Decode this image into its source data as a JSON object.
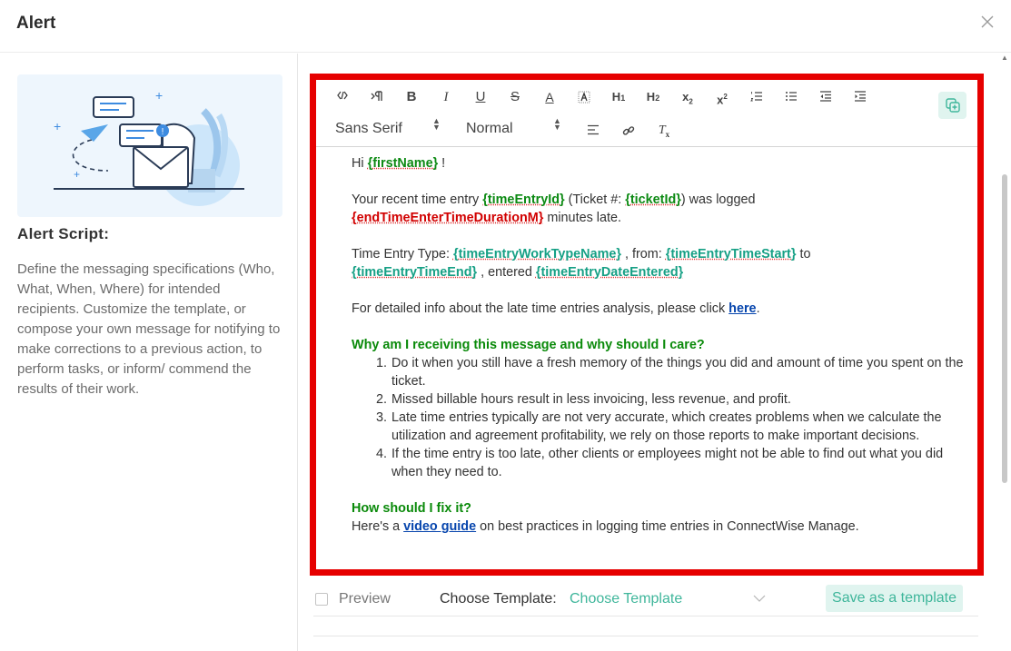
{
  "dialog": {
    "title": "Alert",
    "close_icon": "close-icon"
  },
  "sidebar": {
    "heading": "Alert Script:",
    "description": "Define the messaging specifications (Who, What, When, Where) for intended recipients. Customize the template, or compose your own message for notifying to make corrections to a previous action, to perform tasks, or inform/ commend the results of their work."
  },
  "toolbar": {
    "font_family": "Sans Serif",
    "font_size": "Normal",
    "buttons": [
      "code-view-icon",
      "text-direction-icon",
      "bold-icon",
      "italic-icon",
      "underline-icon",
      "strikethrough-icon",
      "font-color-icon",
      "background-color-icon",
      "heading-1-icon",
      "heading-2-icon",
      "subscript-icon",
      "superscript-icon",
      "ordered-list-icon",
      "bullet-list-icon",
      "outdent-icon",
      "indent-icon",
      "align-icon",
      "link-icon",
      "clear-format-icon",
      "duplicate-icon"
    ],
    "labels": {
      "b": "B",
      "i": "I",
      "u": "U",
      "s": "S",
      "a": "A",
      "h1": "H",
      "h1sub": "1",
      "h2": "H",
      "h2sub": "2",
      "sub": "x",
      "subsub": "2",
      "sup": "x",
      "supsup": "2",
      "tx": "T",
      "txsub": "x"
    }
  },
  "message": {
    "greeting": "Hi",
    "var_first_name": "{firstName}",
    "greeting_end": " !",
    "p1_a": "Your recent time entry ",
    "var_time_entry_id": "{timeEntryId}",
    "p1_b": " (Ticket #: ",
    "var_ticket_id": "{ticketId}",
    "p1_c": ") was logged",
    "var_duration": "{endTimeEnterTimeDurationM}",
    "p1_d": " minutes late.",
    "p2_a": "Time Entry Type: ",
    "var_work_type": "{timeEntryWorkTypeName}",
    "p2_b": " , from: ",
    "var_time_start": "{timeEntryTimeStart}",
    "p2_c": " to",
    "var_time_end": "{timeEntryTimeEnd}",
    "p2_d": " , entered ",
    "var_date_entered": "{timeEntryDateEntered}",
    "p3_a": "For detailed info about the late time entries analysis, please click ",
    "p3_link": "here",
    "p3_b": ".",
    "why_heading": "Why am I receiving this message and why should I care?",
    "reasons": [
      "Do it when you still have a fresh memory of the things you did and amount of time you spent on the ticket.",
      "Missed billable hours result in less invoicing, less revenue, and profit.",
      "Late time entries typically are not very accurate, which creates problems when we calculate the utilization and agreement profitability, we rely on those reports to make important decisions.",
      "If the time entry is too late, other clients or employees might not be able to find out what you did when they need to."
    ],
    "fix_heading": "How should I fix it?",
    "fix_a": "Here's a ",
    "fix_link": "video guide",
    "fix_b": " on best practices in logging time entries in ConnectWise Manage."
  },
  "footer": {
    "preview_label": "Preview",
    "preview_checked": false,
    "choose_template_label": "Choose Template:",
    "choose_template_value": "Choose Template",
    "save_template_label": "Save as a template"
  },
  "colors": {
    "accent": "#3fb69b",
    "accent_bg": "#e0f4ef",
    "highlight_border": "#e60000",
    "variable_teal": "#16a085",
    "variable_green": "#0c8a13",
    "variable_red": "#d10000",
    "heading_green": "#0a8a0a",
    "link": "#0645ad"
  }
}
